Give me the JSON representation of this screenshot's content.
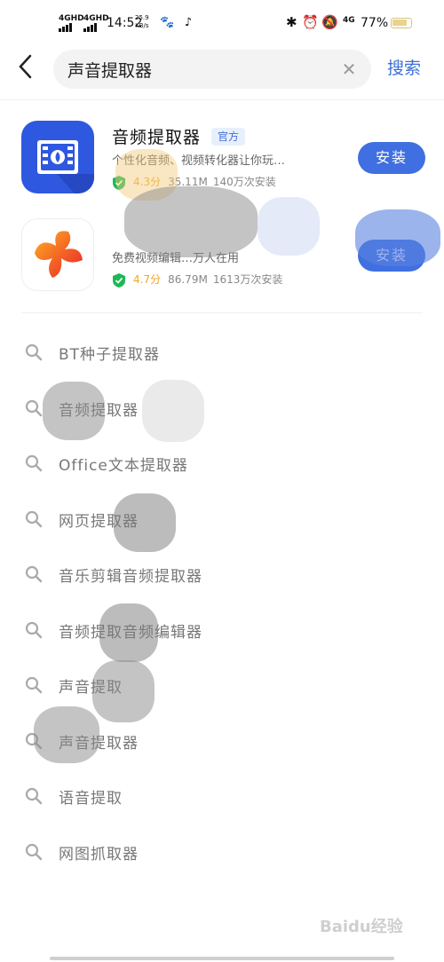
{
  "status_bar": {
    "signal_1": "4GHD",
    "signal_2": "4GHD",
    "time": "14:52",
    "speed_value": "25.9",
    "speed_unit": "KB/s",
    "network": "4G",
    "battery": "77%"
  },
  "search": {
    "query": "声音提取器",
    "action_label": "搜索"
  },
  "apps": [
    {
      "name": "音频提取器",
      "badge": "官方",
      "description": "个性化音频、视频转化器让你玩…",
      "rating": "4.3分",
      "size": "35.11M",
      "installs": "140万次安装",
      "install_label": "安装",
      "icon_color": "#2f58e0"
    },
    {
      "name": "",
      "badge": "",
      "description": "免费视频编辑…万人在用",
      "rating": "4.7分",
      "size": "86.79M",
      "installs": "1613万次安装",
      "install_label": "安装",
      "icon_color": "#f04a2a"
    }
  ],
  "suggestions": [
    "BT种子提取器",
    "音频提取器",
    "Office文本提取器",
    "网页提取器",
    "音乐剪辑音频提取器",
    "音频提取音频编辑器",
    "声音提取",
    "声音提取器",
    "语音提取",
    "网图抓取器"
  ],
  "watermark": "Baidu经验"
}
